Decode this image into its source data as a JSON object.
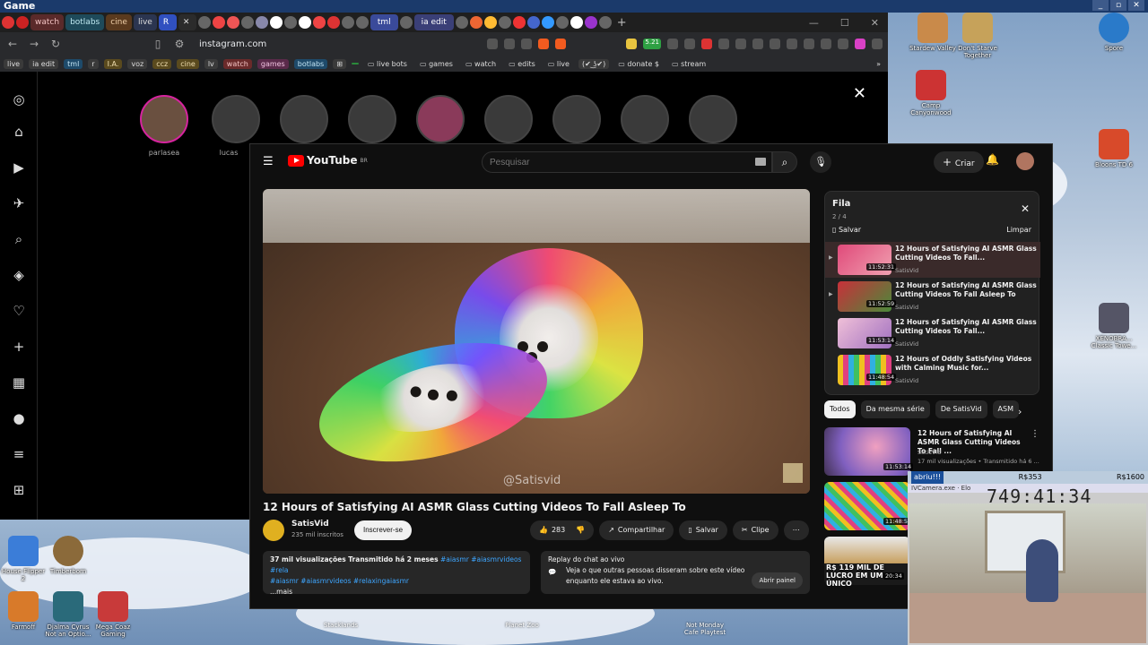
{
  "window": {
    "title": "Game"
  },
  "tabs": [
    "watch",
    "botlabs",
    "cine",
    "live",
    "R",
    "ia edit",
    "tml"
  ],
  "address": {
    "url": "instagram.com",
    "badge": "5.21"
  },
  "bookmarks": [
    "live",
    "ia edit",
    "tml",
    "r",
    "I.A.",
    "voz",
    "ccz",
    "cine",
    "lv",
    "watch",
    "games",
    "botlabs",
    "live bots",
    "games",
    "watch",
    "edits",
    "live",
    "(✔︎ ͜ʖ✔︎)",
    "donate $",
    "stream"
  ],
  "instagram": {
    "stories": [
      "parlasea",
      "lucas"
    ]
  },
  "youtube": {
    "logo": "YouTube",
    "region": "BR",
    "search_placeholder": "Pesquisar",
    "create_label": "Criar",
    "video": {
      "title": "12 Hours of Satisfying AI ASMR Glass Cutting Videos To Fall Asleep To",
      "watermark": "@Satisvid",
      "channel": "SatisVid",
      "subscribers": "235 mil inscritos",
      "subscribe_label": "Inscrever-se",
      "likes": "283",
      "share_label": "Compartilhar",
      "save_label": "Salvar",
      "clip_label": "Clipe",
      "more_label": "⋯",
      "description": {
        "stats": "37 mil visualizações  Transmitido há 2 meses",
        "tags_line1": "#aiasmr #aiasmrvideos #rela",
        "tags_line2": "#aiasmr #aiasmrvideos #relaxingaiasmr",
        "more": "...mais"
      },
      "chat": {
        "title": "Replay do chat ao vivo",
        "text": "Veja o que outras pessoas disseram sobre este vídeo enquanto ele estava ao vivo.",
        "open_label": "Abrir painel"
      }
    },
    "queue": {
      "title": "Fila",
      "count": "2 / 4",
      "save_label": "Salvar",
      "clear_label": "Limpar",
      "items": [
        {
          "title": "12 Hours of Satisfying AI ASMR Glass Cutting Videos To Fall...",
          "channel": "SatisVid",
          "duration": "11:52:31"
        },
        {
          "title": "12 Hours of Satisfying AI ASMR Glass Cutting Videos To Fall Asleep To",
          "channel": "SatisVid",
          "duration": "11:52:59"
        },
        {
          "title": "12 Hours of Satisfying AI ASMR Glass Cutting Videos To Fall...",
          "channel": "SatisVid",
          "duration": "11:53:14"
        },
        {
          "title": "12 Hours of Oddly Satisfying Videos with Calming Music for...",
          "channel": "SatisVid",
          "duration": "11:48:54"
        }
      ]
    },
    "chips": [
      "Todos",
      "Da mesma série",
      "De SatisVid",
      "ASM"
    ],
    "recommendations": [
      {
        "title": "12 Hours of Satisfying AI ASMR Glass Cutting Videos To Fall ...",
        "channel": "SatisVid",
        "meta": "17 mil visualizações • Transmitido há 6 ...",
        "duration": "11:53:14"
      },
      {
        "title": "",
        "channel": "",
        "meta": "",
        "duration": "11:48:54"
      },
      {
        "title": "",
        "channel": "",
        "meta": "",
        "duration": "20:34",
        "overlay": "R$ 119 MIL DE LUCRO EM UM ÚNICO"
      }
    ]
  },
  "desktop_icons": {
    "right_top": [
      "Stardew Valley",
      "Don't Starve Together",
      "Spore"
    ],
    "camp": "Camp Canyonwood",
    "bloons": "Bloons TD 6",
    "xeno": "XENOBRA... Classic Towe...",
    "left": [
      "House Flipper 2",
      "Timberborn",
      "Farmoff",
      "Djalma Cyrus Not an Optio...",
      "Mega Coaz Gaming"
    ],
    "taskbar": [
      "Stacklands",
      "Planet Zoo",
      "Not Monday Cafe Playtest"
    ]
  },
  "stream": {
    "label": "abriu!!!",
    "money1": "R$353",
    "money2": "R$1600",
    "cam_title": "IVCamera.exe",
    "timer": "749:41:34",
    "sub": "Elo"
  }
}
